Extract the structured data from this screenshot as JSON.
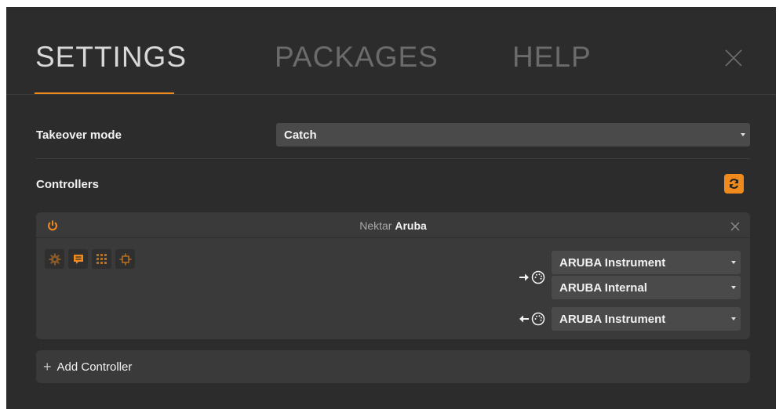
{
  "tabs": [
    {
      "label": "SETTINGS"
    },
    {
      "label": "PACKAGES"
    },
    {
      "label": "HELP"
    }
  ],
  "colors": {
    "accent": "#f08a1c",
    "panel": "#2c2c2c",
    "card": "#3a3a3a",
    "select": "#4a4a4a"
  },
  "settings": {
    "takeover_label": "Takeover mode",
    "takeover_value": "Catch",
    "controllers_label": "Controllers"
  },
  "controller": {
    "brand": "Nektar",
    "model": "Aruba",
    "inputs": [
      "ARUBA Instrument",
      "ARUBA Internal"
    ],
    "output": "ARUBA Instrument"
  },
  "add_controller": {
    "label": "Add Controller",
    "icon": "plus-icon"
  },
  "icons": [
    "close-icon",
    "refresh-icon",
    "power-icon",
    "gear-icon",
    "speech-bubble-icon",
    "grid-icon",
    "crosshair-icon",
    "midi-in-icon",
    "midi-out-icon"
  ]
}
